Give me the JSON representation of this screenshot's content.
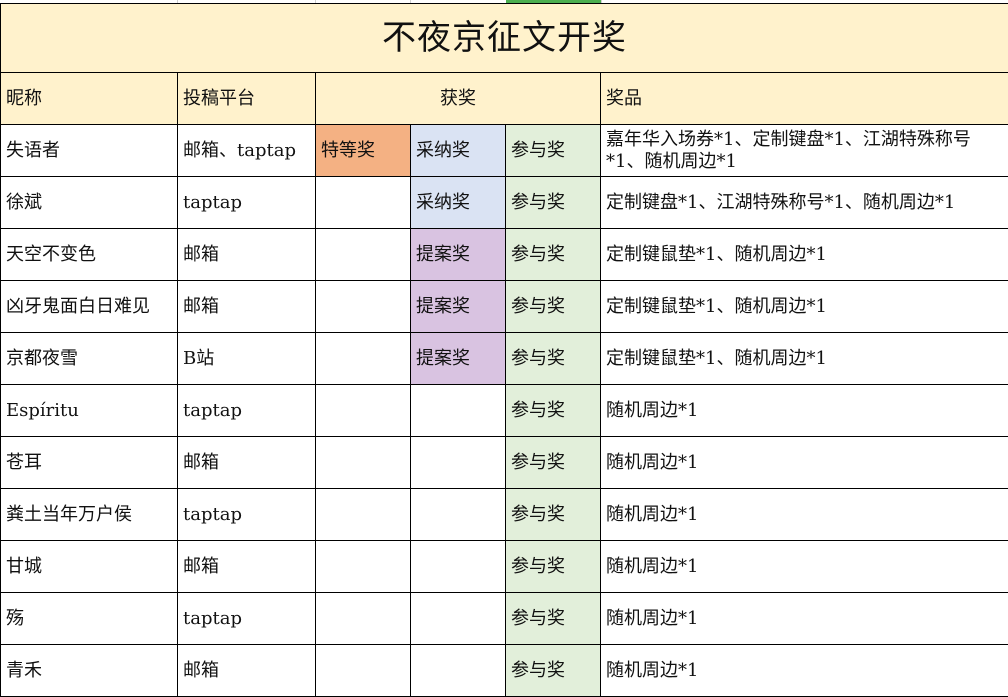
{
  "title": "不夜京征文开奖",
  "headers": {
    "nickname": "昵称",
    "platform": "投稿平台",
    "award": "获奖",
    "prize": "奖品"
  },
  "colors": {
    "header_bg": "#fff2cc",
    "special_award_bg": "#f4b183",
    "adopt_award_bg": "#dae3f3",
    "proposal_award_bg": "#d9c3e1",
    "participation_award_bg": "#e2efda",
    "selection_accent": "#4caf50"
  },
  "rows": [
    {
      "nickname": "失语者",
      "platform": "邮箱、taptap",
      "award1": "特等奖",
      "award2": "采纳奖",
      "award3": "参与奖",
      "prize": "嘉年华入场券*1、定制键盘*1、江湖特殊称号*1、随机周边*1"
    },
    {
      "nickname": "徐斌",
      "platform": "taptap",
      "award1": "",
      "award2": "采纳奖",
      "award3": "参与奖",
      "prize": "定制键盘*1、江湖特殊称号*1、随机周边*1"
    },
    {
      "nickname": "天空不变色",
      "platform": "邮箱",
      "award1": "",
      "award2": "提案奖",
      "award3": "参与奖",
      "prize": "定制键鼠垫*1、随机周边*1"
    },
    {
      "nickname": "凶牙鬼面白日难见",
      "platform": "邮箱",
      "award1": "",
      "award2": "提案奖",
      "award3": "参与奖",
      "prize": "定制键鼠垫*1、随机周边*1"
    },
    {
      "nickname": "京都夜雪",
      "platform": "B站",
      "award1": "",
      "award2": "提案奖",
      "award3": "参与奖",
      "prize": "定制键鼠垫*1、随机周边*1"
    },
    {
      "nickname": "Espíritu",
      "platform": "taptap",
      "award1": "",
      "award2": "",
      "award3": "参与奖",
      "prize": "随机周边*1"
    },
    {
      "nickname": "苍耳",
      "platform": "邮箱",
      "award1": "",
      "award2": "",
      "award3": "参与奖",
      "prize": "随机周边*1"
    },
    {
      "nickname": "粪土当年万户侯",
      "platform": "taptap",
      "award1": "",
      "award2": "",
      "award3": "参与奖",
      "prize": "随机周边*1"
    },
    {
      "nickname": "甘城",
      "platform": "邮箱",
      "award1": "",
      "award2": "",
      "award3": "参与奖",
      "prize": "随机周边*1"
    },
    {
      "nickname": "殇",
      "platform": "taptap",
      "award1": "",
      "award2": "",
      "award3": "参与奖",
      "prize": "随机周边*1"
    },
    {
      "nickname": "青禾",
      "platform": "邮箱",
      "award1": "",
      "award2": "",
      "award3": "参与奖",
      "prize": "随机周边*1"
    }
  ]
}
